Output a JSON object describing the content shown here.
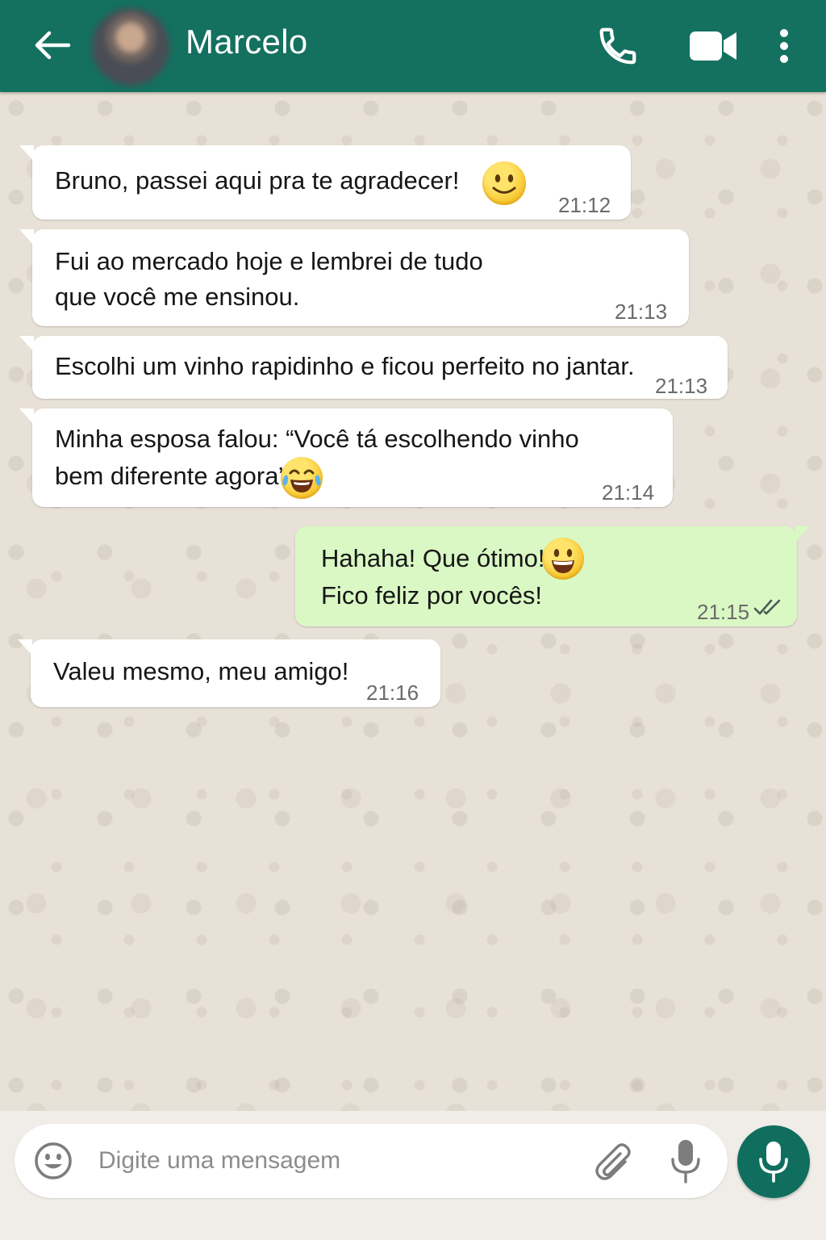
{
  "header": {
    "contact_name": "Marcelo",
    "color": "#14705f"
  },
  "messages": [
    {
      "direction": "incoming",
      "text": "Bruno, passei aqui pra te agradecer!",
      "emoji": "smiling-face",
      "time": "21:12"
    },
    {
      "direction": "incoming",
      "text_lines": [
        "Fui ao mercado hoje e lembrei de tudo",
        "que você me ensinou."
      ],
      "time": "21:13"
    },
    {
      "direction": "incoming",
      "text": "Escolhi um vinho rapidinho e ficou perfeito no jantar.",
      "time": "21:13"
    },
    {
      "direction": "incoming",
      "text_lines": [
        "Minha esposa falou: “Você tá escolhendo vinho",
        "bem diferente agora”"
      ],
      "emoji": "tears-of-joy",
      "time": "21:14"
    },
    {
      "direction": "outgoing",
      "text_lines": [
        "Hahaha! Que ótimo!",
        "Fico feliz por vocês!"
      ],
      "emoji": "grinning-face",
      "time": "21:15",
      "status": "read-double-check"
    },
    {
      "direction": "incoming",
      "text": "Valeu mesmo, meu amigo!",
      "time": "21:16"
    }
  ],
  "input": {
    "placeholder": "Digite uma mensagem",
    "value": ""
  },
  "colors": {
    "incoming_bubble": "#ffffff",
    "outgoing_bubble": "#d9f8c4",
    "chat_background": "#e8e1d7",
    "mic_button": "#0f6e5d"
  }
}
